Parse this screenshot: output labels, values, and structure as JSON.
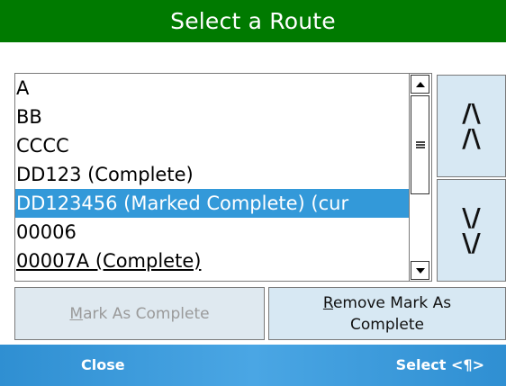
{
  "header": {
    "title": "Select a Route"
  },
  "route_list": {
    "items": [
      {
        "label": "A",
        "selected": false
      },
      {
        "label": "BB",
        "selected": false
      },
      {
        "label": "CCCC",
        "selected": false
      },
      {
        "label": "DD123 (Complete)",
        "selected": false
      },
      {
        "label": "DD123456 (Marked Complete) (cur",
        "selected": true
      },
      {
        "label": "00006",
        "selected": false
      },
      {
        "label": "00007A (Complete)",
        "selected": false
      }
    ]
  },
  "side_buttons": {
    "up_label": "/\\\n/\\",
    "down_label": "\\/\n\\/"
  },
  "actions": {
    "mark_complete_underlined": "M",
    "mark_complete_rest": "ark As Complete",
    "remove_mark_underlined": "R",
    "remove_mark_rest_line1": "emove Mark As",
    "remove_mark_line2": "Complete"
  },
  "softkeys": {
    "left": "Close",
    "right": "Select <¶>"
  },
  "colors": {
    "header_bg": "#007a00",
    "selection_bg": "#3399d9",
    "button_bg": "#d7e8f3",
    "softkey_bg": "#2f8fd2"
  }
}
